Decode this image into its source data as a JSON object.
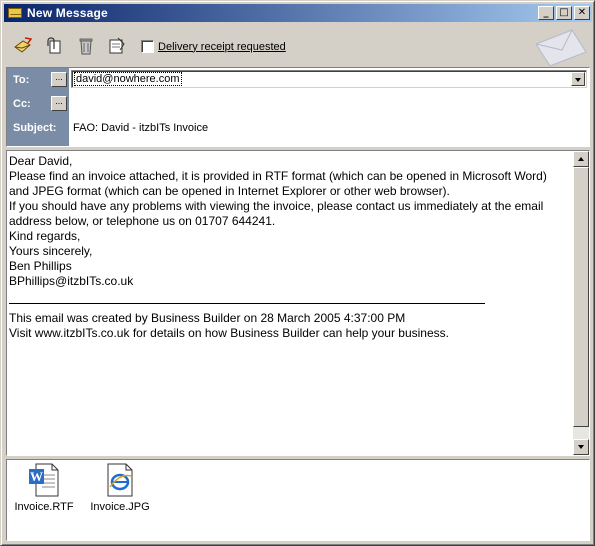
{
  "window": {
    "title": "New Message"
  },
  "titlebar_buttons": {
    "minimize": "_",
    "maximize": "□",
    "close": "✕"
  },
  "toolbar": {
    "icons": [
      "send-icon",
      "attach-icon",
      "delete-icon",
      "address-book-icon"
    ],
    "receipt_label": "Delivery receipt requested",
    "receipt_checked": false
  },
  "header": {
    "to_label": "To:",
    "cc_label": "Cc:",
    "subject_label": "Subject:",
    "to_value": "david@nowhere.com",
    "cc_value": "",
    "subject_value": "FAO: David - itzbITs Invoice",
    "dots": "..."
  },
  "body": {
    "lines": [
      "Dear David,",
      "",
      "Please find an invoice attached, it is provided in RTF format (which can be opened in Microsoft Word)",
      "and JPEG format (which can be opened in Internet Explorer or other web browser).",
      "",
      "If you should have any problems with viewing the invoice, please contact us immediately at the email",
      "address below, or telephone us on 01707 644241.",
      "",
      "Kind regards,",
      "",
      "Yours sincerely,",
      "",
      "",
      "Ben Phillips",
      "BPhillips@itzbITs.co.uk"
    ],
    "footer_lines": [
      "This email was created by Business Builder on 28 March 2005 4:37:00 PM",
      "Visit www.itzbITs.co.uk for details on how Business Builder can help your business."
    ]
  },
  "attachments": [
    {
      "name": "Invoice.RTF",
      "icon": "word-document-icon"
    },
    {
      "name": "Invoice.JPG",
      "icon": "ie-image-icon"
    }
  ],
  "colors": {
    "titlebar_start": "#0a246a",
    "titlebar_end": "#a6caf0",
    "header_label_bg": "#7b8da6",
    "face": "#d4d0c8"
  }
}
